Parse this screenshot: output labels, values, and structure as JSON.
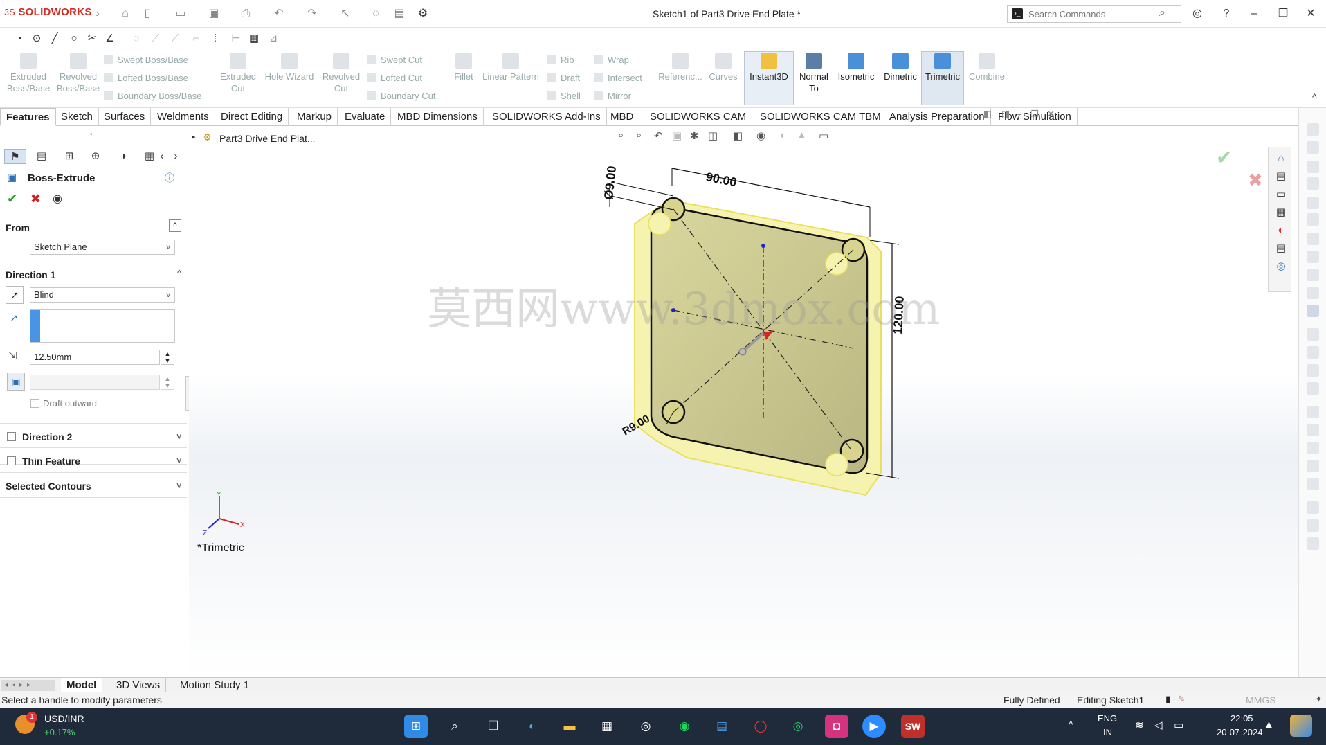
{
  "app": {
    "logo_prefix": "3S",
    "logo_text": "SOLIDWORKS",
    "document_title": "Sketch1 of Part3 Drive End Plate *"
  },
  "search": {
    "placeholder": "Search Commands"
  },
  "ribbon": {
    "large": [
      {
        "label": "Extruded\nBoss/Base",
        "enabled": false
      },
      {
        "label": "Revolved\nBoss/Base",
        "enabled": false
      },
      {
        "label": "Extruded\nCut",
        "enabled": false
      },
      {
        "label": "Hole Wizard",
        "enabled": false
      },
      {
        "label": "Revolved\nCut",
        "enabled": false
      },
      {
        "label": "Fillet",
        "enabled": false
      },
      {
        "label": "Linear Pattern",
        "enabled": false
      },
      {
        "label": "Referenc...",
        "enabled": false
      },
      {
        "label": "Curves",
        "enabled": false
      },
      {
        "label": "Instant3D",
        "enabled": true
      },
      {
        "label": "Normal\nTo",
        "enabled": true
      },
      {
        "label": "Isometric",
        "enabled": true
      },
      {
        "label": "Dimetric",
        "enabled": true
      },
      {
        "label": "Trimetric",
        "enabled": true
      },
      {
        "label": "Combine",
        "enabled": false
      }
    ],
    "small": [
      "Swept Boss/Base",
      "Lofted Boss/Base",
      "Boundary Boss/Base",
      "Swept Cut",
      "Lofted Cut",
      "Boundary Cut",
      "Rib",
      "Draft",
      "Shell",
      "Wrap",
      "Intersect",
      "Mirror"
    ]
  },
  "tabs": [
    "Features",
    "Sketch",
    "Surfaces",
    "Weldments",
    "Direct Editing",
    "Markup",
    "Evaluate",
    "MBD Dimensions",
    "SOLIDWORKS Add-Ins",
    "MBD",
    "SOLIDWORKS CAM",
    "SOLIDWORKS CAM TBM",
    "Analysis Preparation",
    "Flow Simulation"
  ],
  "active_tab": "Features",
  "property_manager": {
    "title": "Boss-Extrude",
    "from": {
      "label": "From",
      "value": "Sketch Plane"
    },
    "direction1": {
      "label": "Direction 1",
      "end_condition": "Blind",
      "depth": "12.50mm",
      "draft_label": "Draft outward"
    },
    "direction2": {
      "label": "Direction 2"
    },
    "thin_feature": {
      "label": "Thin Feature"
    },
    "selected_contours": {
      "label": "Selected Contours"
    }
  },
  "viewport": {
    "tree_item": "Part3 Drive End Plat...",
    "view_name": "*Trimetric",
    "dimensions": {
      "width": "90.00",
      "height": "120.00",
      "hole_dia": "Ø9.00",
      "radius": "R9.00"
    },
    "watermark": "莫西网www.3dmox.com"
  },
  "bottom_tabs": [
    "Model",
    "3D Views",
    "Motion Study 1"
  ],
  "status": {
    "left": "Select a handle to modify parameters",
    "fully_defined": "Fully Defined",
    "editing": "Editing Sketch1",
    "units": "MMGS"
  },
  "taskbar": {
    "stock_name": "USD/INR",
    "stock_change": "+0.17%",
    "badge": "1",
    "lang1": "ENG",
    "lang2": "IN",
    "time": "22:05",
    "date": "20-07-2024"
  }
}
